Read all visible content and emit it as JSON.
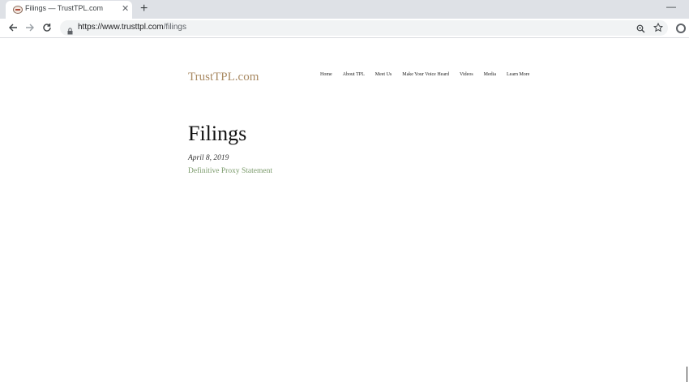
{
  "browser": {
    "tab": {
      "title": "Filings — TrustTPL.com",
      "close_glyph": "✕"
    },
    "new_tab_glyph": "+",
    "minimize_glyph": "—",
    "url": {
      "base": "https://www.trusttpl.com",
      "path": "/filings"
    },
    "icons": {
      "back": "back-arrow-icon",
      "forward": "forward-arrow-icon",
      "reload": "reload-icon",
      "lock": "lock-icon",
      "zoom": "zoom-icon",
      "bookmark": "star-icon",
      "extension": "extension-icon"
    }
  },
  "site": {
    "logo": "TrustTPL.com",
    "nav": [
      "Home",
      "About TPL",
      "Meet Us",
      "Make Your Voice Heard",
      "Videos",
      "Media",
      "Learn More"
    ]
  },
  "main": {
    "title": "Filings",
    "entry": {
      "date": "April 8, 2019",
      "link_text": "Definitive Proxy Statement"
    }
  },
  "colors": {
    "logo": "#a98a63",
    "link": "#7a9a6a",
    "tabstrip": "#dee1e6",
    "omnibox": "#f1f3f4"
  }
}
